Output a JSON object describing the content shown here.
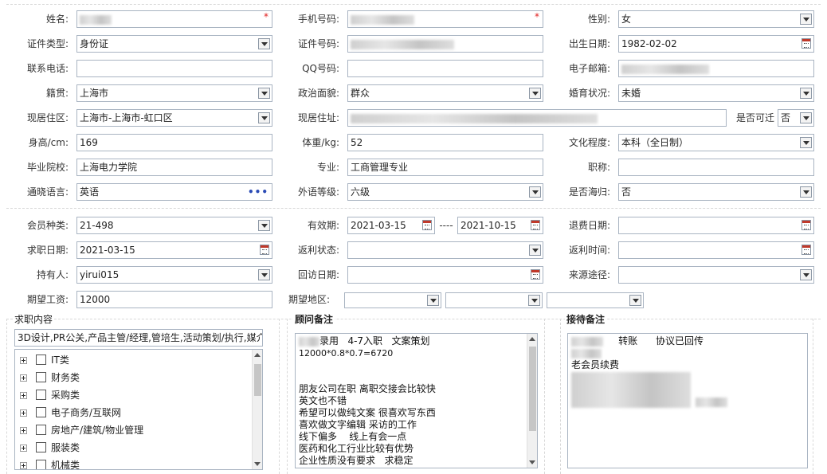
{
  "basic": {
    "name_label": "姓名:",
    "phone_label": "手机号码:",
    "gender_label": "性别:",
    "gender_value": "女",
    "idtype_label": "证件类型:",
    "idtype_value": "身份证",
    "idno_label": "证件号码:",
    "birth_label": "出生日期:",
    "birth_value": "1982-02-02",
    "contact_label": "联系电话:",
    "qq_label": "QQ号码:",
    "email_label": "电子邮箱:",
    "native_label": "籍贯:",
    "native_value": "上海市",
    "political_label": "政治面貌:",
    "political_value": "群众",
    "marital_label": "婚育状况:",
    "marital_value": "未婚",
    "district_label": "现居住区:",
    "district_value": "上海市-上海市-虹口区",
    "address_label": "现居住址:",
    "relocate_label": "是否可迁",
    "relocate_value": "否",
    "height_label": "身高/cm:",
    "height_value": "169",
    "weight_label": "体重/kg:",
    "weight_value": "52",
    "education_label": "文化程度:",
    "education_value": "本科（全日制）",
    "school_label": "毕业院校:",
    "school_value": "上海电力学院",
    "major_label": "专业:",
    "major_value": "工商管理专业",
    "title_label": "职称:",
    "language_label": "通晓语言:",
    "language_value": "英语",
    "foreign_label": "外语等级:",
    "foreign_value": "六级",
    "overseas_label": "是否海归:",
    "overseas_value": "否"
  },
  "membership": {
    "type_label": "会员种类:",
    "type_value": "21-498",
    "valid_label": "有效期:",
    "valid_from": "2021-03-15",
    "valid_dash": "----",
    "valid_to": "2021-10-15",
    "refund_label": "退费日期:",
    "jobdate_label": "求职日期:",
    "jobdate_value": "2021-03-15",
    "rebate_state_label": "返利状态:",
    "rebate_time_label": "返利时间:",
    "holder_label": "持有人:",
    "holder_value": "yirui015",
    "visit_label": "回访日期:",
    "source_label": "来源途径:",
    "salary_label": "期望工资:",
    "salary_value": "12000",
    "area_label": "期望地区:"
  },
  "job": {
    "title": "求职内容",
    "selected": "3D设计,PR公关,产品主管/经理,管培生,活动策划/执行,媒介",
    "categories": [
      "IT类",
      "财务类",
      "采购类",
      "电子商务/互联网",
      "房地产/建筑/物业管理",
      "服装类",
      "机械类"
    ]
  },
  "advisor": {
    "title": "顾问备注",
    "line1": "录用   4-7入职   文案策划",
    "line2": "12000*0.8*0.7=6720",
    "line3": "朋友公司在职 离职交接会比较快",
    "line4": "英文也不错",
    "line5": "希望可以做纯文案 很喜欢写东西",
    "line6": "喜欢做文字编辑 采访的工作",
    "line7": "线下偏多    线上有会一点",
    "line8": "医药和化工行业比较有优势",
    "line9": "企业性质没有要求   求稳定"
  },
  "reception": {
    "title": "接待备注",
    "line1": "转账      协议已回传",
    "line2": "老会员续费"
  }
}
